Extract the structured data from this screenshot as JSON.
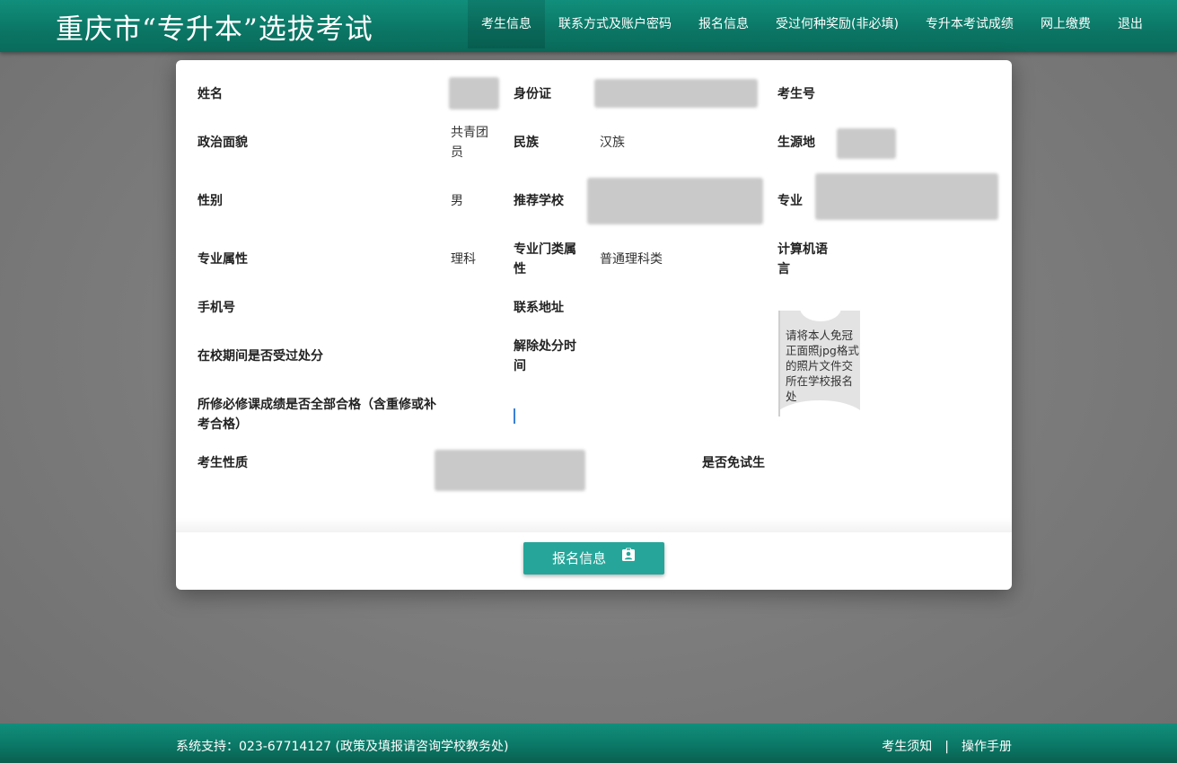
{
  "header": {
    "title": "重庆市“专升本”选拔考试",
    "nav": [
      {
        "label": "考生信息",
        "active": true
      },
      {
        "label": "联系方式及账户密码",
        "active": false
      },
      {
        "label": "报名信息",
        "active": false
      },
      {
        "label": "受过何种奖励(非必填)",
        "active": false
      },
      {
        "label": "专升本考试成绩",
        "active": false
      },
      {
        "label": "网上缴费",
        "active": false
      },
      {
        "label": "退出",
        "active": false
      }
    ]
  },
  "form": {
    "name_label": "姓名",
    "id_label": "身份证",
    "exam_no_label": "考生号",
    "political_label": "政治面貌",
    "political_value": "共青团员",
    "ethnic_label": "民族",
    "ethnic_value": "汉族",
    "origin_label": "生源地",
    "gender_label": "性别",
    "gender_value": "男",
    "school_label": "推荐学校",
    "major_label": "专业",
    "major_attr_label": "专业属性",
    "major_attr_value": "理科",
    "category_label": "专业门类属性",
    "category_value": "普通理科类",
    "computer_lang_label": "计算机语言",
    "phone_label": "手机号",
    "address_label": "联系地址",
    "punish_label": "在校期间是否受过处分",
    "punish_lift_label": "解除处分时间",
    "courses_label": "所修必修课成绩是否全部合格（含重修或补考合格）",
    "candidate_type_label": "考生性质",
    "exempt_label": "是否免试生",
    "photo_tip": "请将本人免冠正面照jpg格式的照片文件交所在学校报名处"
  },
  "actions": {
    "next_label": "报名信息",
    "next_icon": "contact-card-icon"
  },
  "footer": {
    "support": "系统支持：023-67714127 (政策及填报请咨询学校教务处)",
    "notice": "考生须知",
    "separator": "|",
    "manual": "操作手册"
  },
  "colors": {
    "header": "#0b7564",
    "accent": "#26a69a"
  }
}
